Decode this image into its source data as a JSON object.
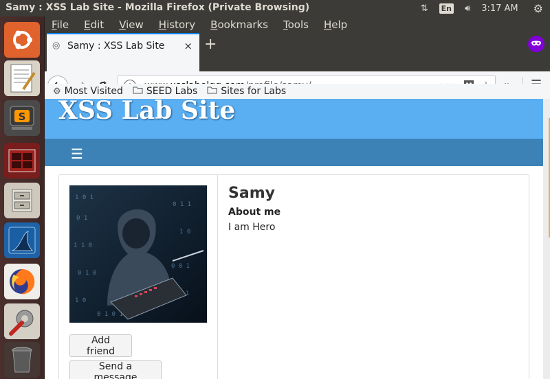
{
  "system": {
    "window_title": "Samy : XSS Lab Site - Mozilla Firefox (Private Browsing)",
    "keyboard_layout": "En",
    "clock": "3:17 AM"
  },
  "launcher": {
    "items": [
      {
        "name": "ubuntu-dash",
        "icon": "ubuntu-icon"
      },
      {
        "name": "text-editor",
        "icon": "text-editor-icon"
      },
      {
        "name": "sublime-text",
        "icon": "sublime-icon"
      },
      {
        "name": "terminal",
        "icon": "terminal-icon"
      },
      {
        "name": "files",
        "icon": "files-icon"
      },
      {
        "name": "wireshark",
        "icon": "wireshark-icon"
      },
      {
        "name": "firefox",
        "icon": "firefox-icon"
      },
      {
        "name": "system-settings",
        "icon": "settings-icon"
      },
      {
        "name": "trash",
        "icon": "trash-icon"
      }
    ]
  },
  "menubar": [
    "File",
    "Edit",
    "View",
    "History",
    "Bookmarks",
    "Tools",
    "Help"
  ],
  "tab": {
    "title": "Samy : XSS Lab Site",
    "close": "×"
  },
  "newtab_label": "+",
  "url": {
    "prefix": "www.",
    "domain": "xsslabelgg.com",
    "path": "/profile/samy/"
  },
  "bookmarks": [
    "Most Visited",
    "SEED Labs",
    "Sites for Labs"
  ],
  "site": {
    "title": "XSS Lab Site",
    "menu_icon": "☰"
  },
  "profile": {
    "name": "Samy",
    "about_label": "About me",
    "about_text": "I am Hero",
    "add_friend": "Add friend",
    "send_message": "Send a message"
  },
  "colors": {
    "header_blue": "#5aaff2",
    "nav_blue": "#3c82b6",
    "private_purple": "#8000d7",
    "accent_tab": "#0a84ff"
  }
}
